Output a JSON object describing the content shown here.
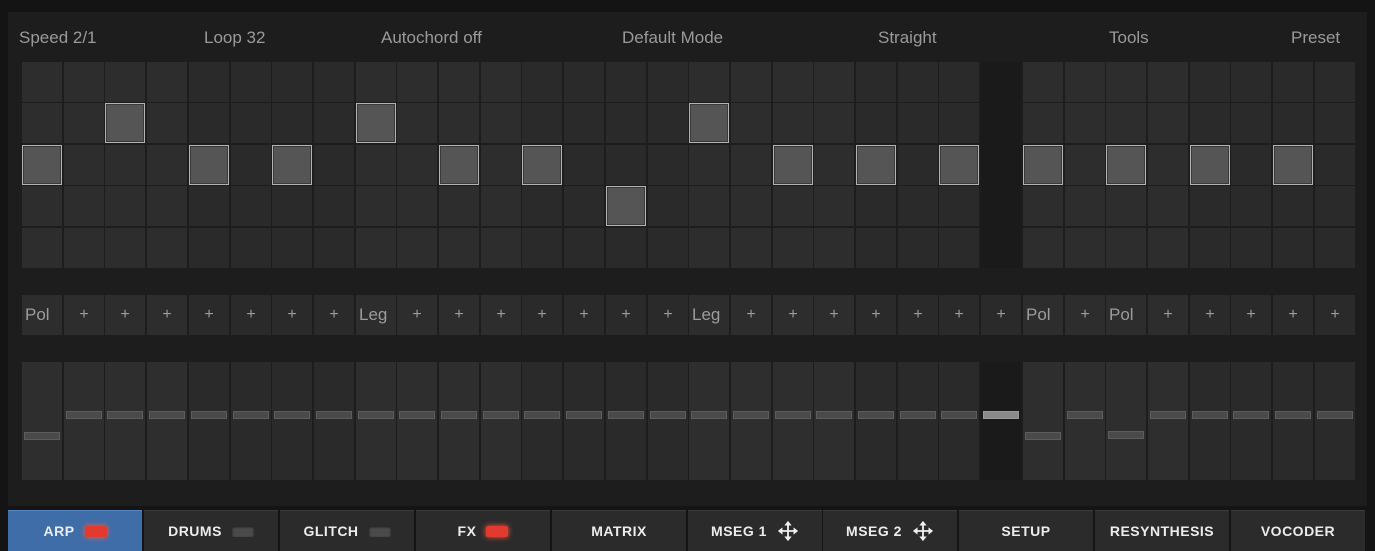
{
  "header": {
    "speed": "Speed 2/1",
    "loop": "Loop 32",
    "autochord": "Autochord off",
    "mode": "Default Mode",
    "groove": "Straight",
    "tools": "Tools",
    "preset": "Preset"
  },
  "sequencer": {
    "steps": 32,
    "rows": 5,
    "current_step": 23,
    "notes": [
      {
        "step": 0,
        "row": 2
      },
      {
        "step": 2,
        "row": 1
      },
      {
        "step": 4,
        "row": 2
      },
      {
        "step": 6,
        "row": 2
      },
      {
        "step": 8,
        "row": 1
      },
      {
        "step": 10,
        "row": 2
      },
      {
        "step": 12,
        "row": 2
      },
      {
        "step": 14,
        "row": 3
      },
      {
        "step": 16,
        "row": 1
      },
      {
        "step": 18,
        "row": 2
      },
      {
        "step": 20,
        "row": 2
      },
      {
        "step": 22,
        "row": 2
      },
      {
        "step": 24,
        "row": 2
      },
      {
        "step": 26,
        "row": 2
      },
      {
        "step": 28,
        "row": 2
      },
      {
        "step": 30,
        "row": 2
      }
    ],
    "gates": [
      "Pol",
      "+",
      "+",
      "+",
      "+",
      "+",
      "+",
      "+",
      "Leg",
      "+",
      "+",
      "+",
      "+",
      "+",
      "+",
      "+",
      "Leg",
      "+",
      "+",
      "+",
      "+",
      "+",
      "+",
      "+",
      "Pol",
      "+",
      "Pol",
      "+",
      "+",
      "+",
      "+",
      "+"
    ],
    "velocity": [
      0.37,
      0.55,
      0.55,
      0.55,
      0.55,
      0.55,
      0.55,
      0.55,
      0.55,
      0.55,
      0.55,
      0.55,
      0.55,
      0.55,
      0.55,
      0.55,
      0.55,
      0.55,
      0.55,
      0.55,
      0.55,
      0.55,
      0.55,
      0.55,
      0.37,
      0.55,
      0.38,
      0.55,
      0.55,
      0.55,
      0.55,
      0.55
    ]
  },
  "tabs": [
    {
      "label": "ARP",
      "led": "on",
      "icon": null
    },
    {
      "label": "DRUMS",
      "led": "off",
      "icon": null
    },
    {
      "label": "GLITCH",
      "led": "off",
      "icon": null
    },
    {
      "label": "FX",
      "led": "on",
      "icon": null
    },
    {
      "label": "MATRIX",
      "led": null,
      "icon": null
    },
    {
      "label": "MSEG 1",
      "led": null,
      "icon": "move-icon"
    },
    {
      "label": "MSEG 2",
      "led": null,
      "icon": "move-icon"
    },
    {
      "label": "SETUP",
      "led": null,
      "icon": null
    },
    {
      "label": "RESYNTHESIS",
      "led": null,
      "icon": null
    },
    {
      "label": "VOCODER",
      "led": null,
      "icon": null
    }
  ],
  "active_tab": "ARP",
  "colors": {
    "active_tab": "#3e6da8",
    "led_on": "#e23a2e",
    "note_active": "#555555",
    "cursor_note": "#a8a8a8"
  }
}
